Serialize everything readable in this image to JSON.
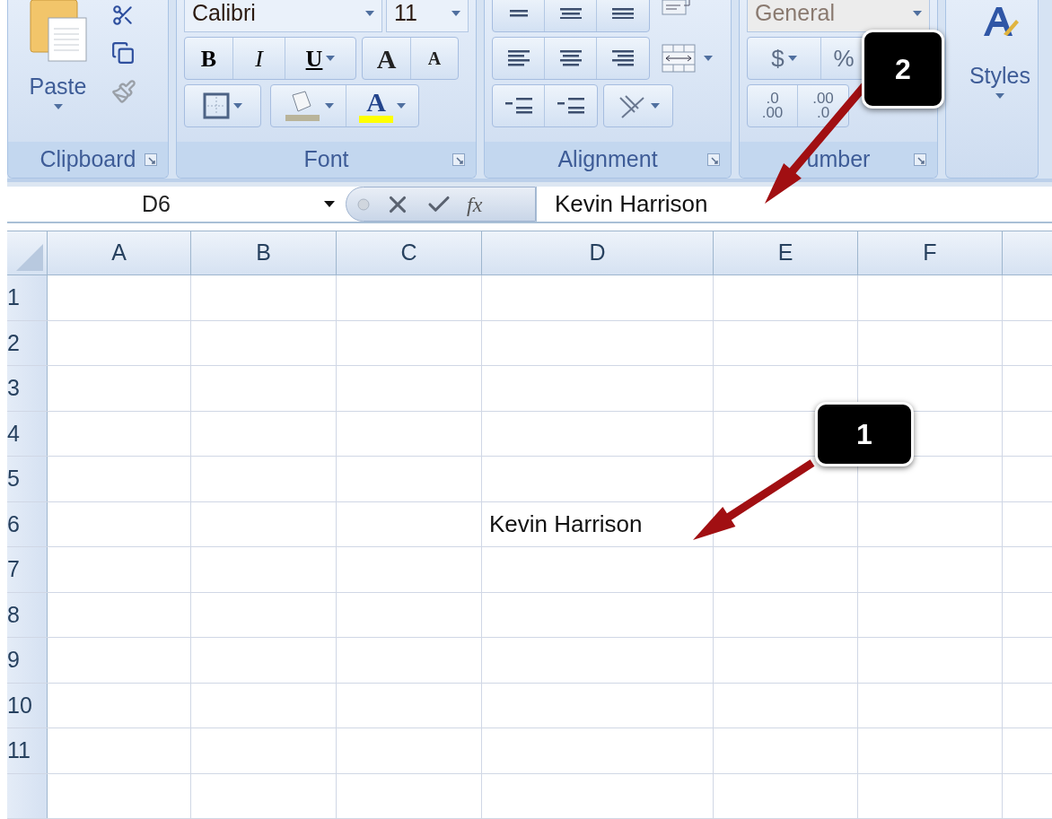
{
  "ribbon": {
    "groups": [
      {
        "kind": "clipboard",
        "label": "Clipboard",
        "paste_label": "Paste"
      },
      {
        "kind": "font",
        "label": "Font",
        "font_name": "Calibri",
        "font_size": "11",
        "bold": "B",
        "italic": "I",
        "underline": "U",
        "grow": "A",
        "shrink": "A",
        "font_color": "A"
      },
      {
        "kind": "alignment",
        "label": "Alignment"
      },
      {
        "kind": "number",
        "label": "umber",
        "format": "General",
        "currency": "$",
        "percent": "%",
        "increase_decimal": [
          ".0",
          ".00"
        ],
        "decrease_decimal": [
          ".00",
          ".0"
        ]
      },
      {
        "kind": "styles",
        "label": "Styles"
      }
    ]
  },
  "formula_bar": {
    "name_box": "D6",
    "function_label": "fx",
    "value": "Kevin Harrison"
  },
  "sheet": {
    "columns": [
      "A",
      "B",
      "C",
      "D",
      "E",
      "F"
    ],
    "rows": [
      {
        "label": "1"
      },
      {
        "label": "2"
      },
      {
        "label": "3"
      },
      {
        "label": "4"
      },
      {
        "label": "5"
      },
      {
        "label": "6",
        "cells": [
          null,
          null,
          null,
          "Kevin Harrison",
          null,
          null
        ]
      },
      {
        "label": "7"
      },
      {
        "label": "8"
      },
      {
        "label": "9"
      },
      {
        "label": "10"
      },
      {
        "label": "11"
      }
    ]
  },
  "callouts": [
    {
      "number": "1"
    },
    {
      "number": "2"
    }
  ]
}
